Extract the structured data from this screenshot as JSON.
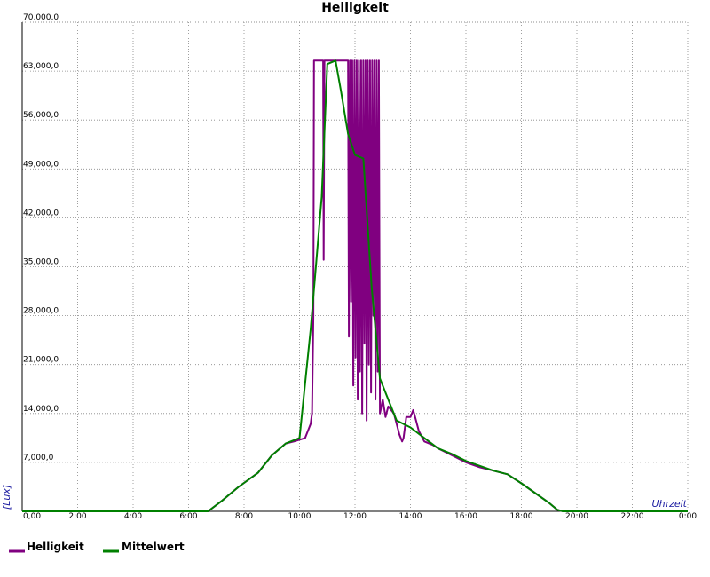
{
  "chart_data": {
    "type": "line",
    "title": "Helligkeit",
    "ylabel": "[Lux]",
    "xlabel": "Uhrzeit",
    "ylim": [
      0,
      70000
    ],
    "xlim": [
      0,
      24
    ],
    "yticks": [
      {
        "value": 0,
        "label": "0,00"
      },
      {
        "value": 7000,
        "label": "7,000,0"
      },
      {
        "value": 14000,
        "label": "14,000,0"
      },
      {
        "value": 21000,
        "label": "21,000,0"
      },
      {
        "value": 28000,
        "label": "28,000,0"
      },
      {
        "value": 35000,
        "label": "35,000,0"
      },
      {
        "value": 42000,
        "label": "42,000,0"
      },
      {
        "value": 49000,
        "label": "49,000,0"
      },
      {
        "value": 56000,
        "label": "56,000,0"
      },
      {
        "value": 63000,
        "label": "63,000,0"
      },
      {
        "value": 70000,
        "label": "70,000,0"
      }
    ],
    "xticks": [
      {
        "value": 2,
        "label": "2:00"
      },
      {
        "value": 4,
        "label": "4:00"
      },
      {
        "value": 6,
        "label": "6:00"
      },
      {
        "value": 8,
        "label": "8:00"
      },
      {
        "value": 10,
        "label": "10:00"
      },
      {
        "value": 12,
        "label": "12:00"
      },
      {
        "value": 14,
        "label": "14:00"
      },
      {
        "value": 16,
        "label": "16:00"
      },
      {
        "value": 18,
        "label": "18:00"
      },
      {
        "value": 20,
        "label": "20:00"
      },
      {
        "value": 22,
        "label": "22:00"
      },
      {
        "value": 24,
        "label": "0:00"
      }
    ],
    "grid": true,
    "legend_position": "bottom-left",
    "series": [
      {
        "name": "Helligkeit",
        "color": "#800080",
        "x": [
          0,
          6.7,
          7.2,
          7.8,
          8.5,
          9.0,
          9.5,
          9.8,
          10.2,
          10.4,
          10.45,
          10.5,
          10.52,
          10.55,
          10.6,
          10.75,
          10.85,
          10.87,
          10.9,
          10.95,
          11.0,
          11.05,
          11.1,
          11.5,
          11.75,
          11.78,
          11.82,
          11.86,
          11.9,
          11.94,
          11.98,
          12.02,
          12.06,
          12.1,
          12.14,
          12.18,
          12.22,
          12.26,
          12.3,
          12.34,
          12.38,
          12.42,
          12.46,
          12.5,
          12.54,
          12.58,
          12.62,
          12.66,
          12.7,
          12.74,
          12.78,
          12.82,
          12.86,
          12.9,
          13.0,
          13.1,
          13.2,
          13.4,
          13.6,
          13.7,
          13.75,
          13.85,
          14.0,
          14.1,
          14.2,
          14.3,
          14.5,
          14.8,
          15.0,
          15.5,
          16.0,
          16.5,
          17.0,
          17.5,
          18.0,
          18.5,
          19.0,
          19.3,
          19.5,
          20.0,
          24.0
        ],
        "y": [
          0,
          0,
          1500,
          3500,
          5500,
          8000,
          9700,
          10000,
          10500,
          12500,
          14000,
          28000,
          64500,
          64500,
          64500,
          64500,
          64500,
          36000,
          64500,
          64500,
          64500,
          64500,
          64500,
          64500,
          64500,
          25000,
          64500,
          30000,
          64500,
          18000,
          64500,
          22000,
          64500,
          16000,
          64500,
          20000,
          64500,
          14000,
          64500,
          24000,
          64500,
          13000,
          64500,
          21000,
          64500,
          17000,
          64500,
          28000,
          64500,
          16000,
          64500,
          20000,
          64500,
          14000,
          16000,
          13500,
          15000,
          14000,
          11000,
          10000,
          10500,
          13500,
          13500,
          14500,
          13000,
          11500,
          10000,
          9500,
          9000,
          8000,
          7000,
          6300,
          5800,
          5300,
          4000,
          2600,
          1200,
          200,
          0,
          0,
          0
        ]
      },
      {
        "name": "Mittelwert",
        "color": "#008000",
        "x": [
          0,
          6.7,
          7.2,
          7.8,
          8.5,
          9.0,
          9.5,
          10.0,
          10.4,
          10.8,
          11.0,
          11.3,
          11.5,
          11.75,
          12.0,
          12.3,
          12.6,
          12.9,
          13.2,
          13.5,
          14.0,
          14.5,
          15.0,
          15.5,
          16.0,
          16.5,
          17.0,
          17.5,
          18.0,
          18.5,
          19.0,
          19.3,
          19.5,
          20.0,
          24.0
        ],
        "y": [
          0,
          0,
          1500,
          3500,
          5500,
          8000,
          9700,
          10500,
          26000,
          45000,
          64000,
          64500,
          60000,
          54000,
          51000,
          50500,
          32000,
          19000,
          16000,
          13000,
          12000,
          10500,
          9000,
          8200,
          7200,
          6500,
          5800,
          5300,
          4000,
          2600,
          1200,
          200,
          0,
          0,
          0
        ]
      }
    ]
  }
}
